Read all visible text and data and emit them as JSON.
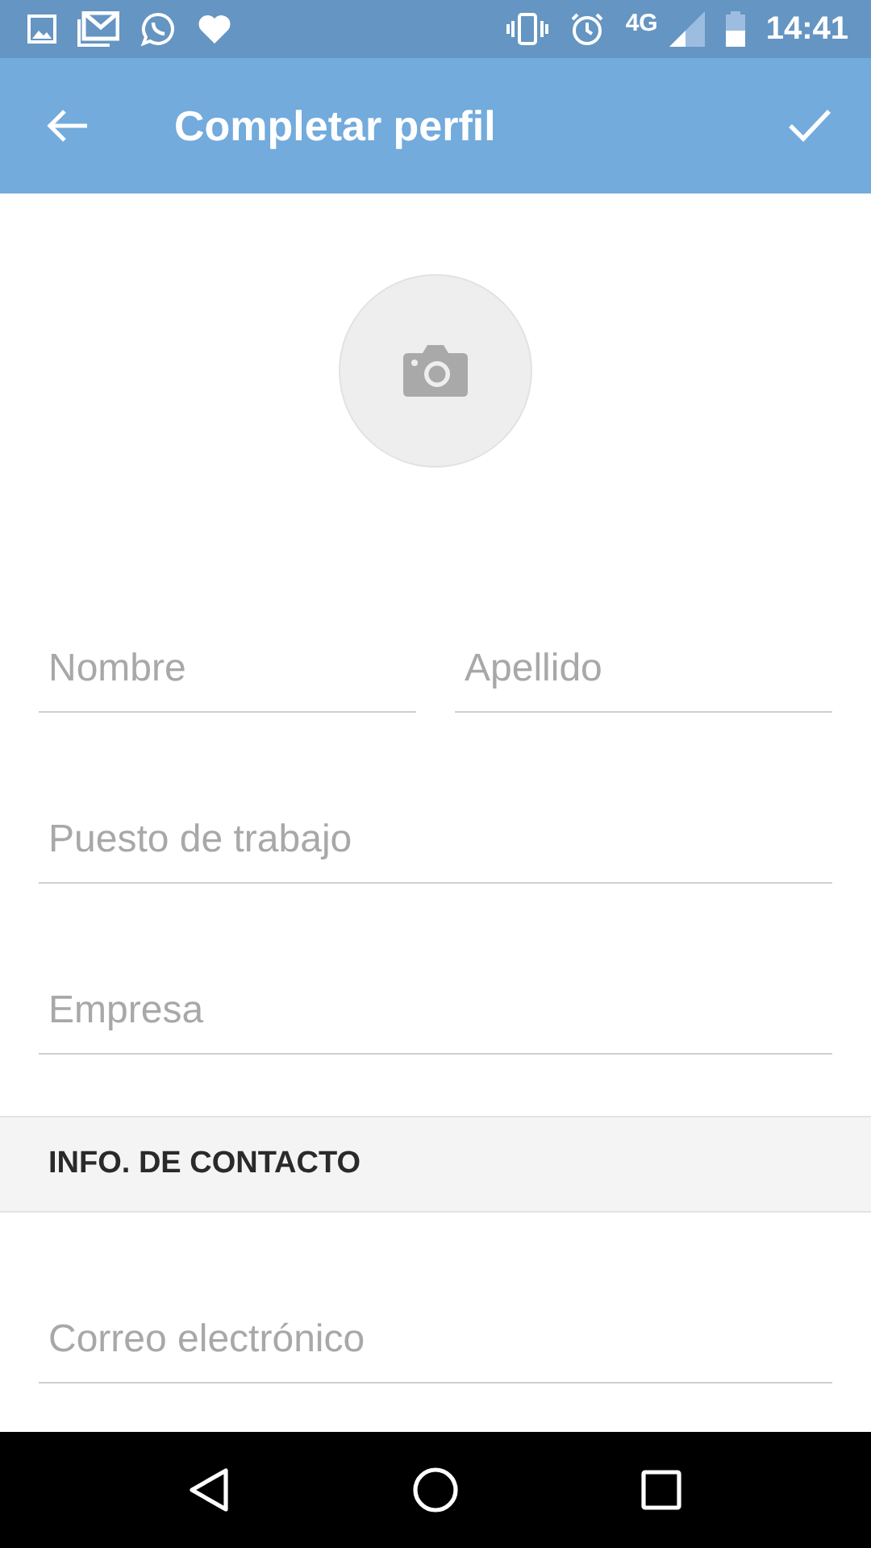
{
  "status_bar": {
    "network": "4G",
    "time": "14:41"
  },
  "toolbar": {
    "title": "Completar perfil"
  },
  "profile_rows": [
    {
      "fields": [
        {
          "placeholder": "Nombre"
        },
        {
          "placeholder": "Apellido"
        }
      ]
    },
    {
      "fields": [
        {
          "placeholder": "Puesto de trabajo"
        }
      ]
    },
    {
      "fields": [
        {
          "placeholder": "Empresa"
        }
      ]
    }
  ],
  "contact_section": {
    "title": "INFO. DE CONTACTO",
    "fields": [
      {
        "placeholder": "Correo electrónico"
      }
    ]
  }
}
